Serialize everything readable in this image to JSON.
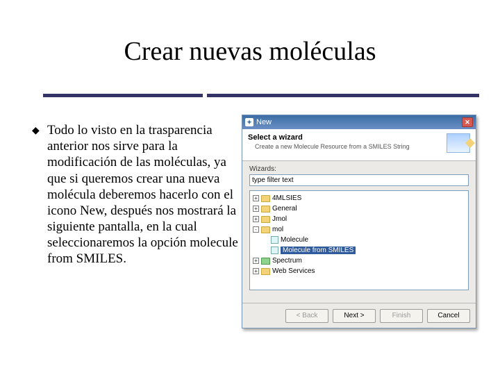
{
  "slide": {
    "title": "Crear nuevas moléculas",
    "bullet": "Todo lo visto en la trasparencia anterior nos sirve para la modificación de las moléculas, ya que si queremos crear una nueva molécula deberemos hacerlo con el icono New, después nos mostrará la siguiente pantalla, en la cual seleccionaremos la opción molecule from SMILES."
  },
  "dialog": {
    "window_title": "New",
    "header_title": "Select a wizard",
    "header_subtitle": "Create a new Molecule Resource from a SMILES String",
    "filter_label": "Wizards:",
    "filter_value": "type filter text",
    "tree": [
      {
        "level": 0,
        "toggle": "+",
        "folder": "yellow",
        "label": "4MLSIES",
        "selected": false
      },
      {
        "level": 0,
        "toggle": "+",
        "folder": "yellow",
        "label": "General",
        "selected": false
      },
      {
        "level": 0,
        "toggle": "+",
        "folder": "yellow",
        "label": "Jmol",
        "selected": false
      },
      {
        "level": 0,
        "toggle": "-",
        "folder": "yellow",
        "label": "mol",
        "selected": false
      },
      {
        "level": 1,
        "toggle": "",
        "leaf": true,
        "label": "Molecule",
        "selected": false
      },
      {
        "level": 1,
        "toggle": "",
        "leaf": true,
        "label": "Molecule from SMILES",
        "selected": true
      },
      {
        "level": 0,
        "toggle": "+",
        "folder": "green",
        "label": "Spectrum",
        "selected": false
      },
      {
        "level": 0,
        "toggle": "+",
        "folder": "yellow",
        "label": "Web Services",
        "selected": false
      }
    ],
    "buttons": {
      "back": {
        "label": "< Back",
        "enabled": false
      },
      "next": {
        "label": "Next >",
        "enabled": true
      },
      "finish": {
        "label": "Finish",
        "enabled": false
      },
      "cancel": {
        "label": "Cancel",
        "enabled": true
      }
    }
  }
}
